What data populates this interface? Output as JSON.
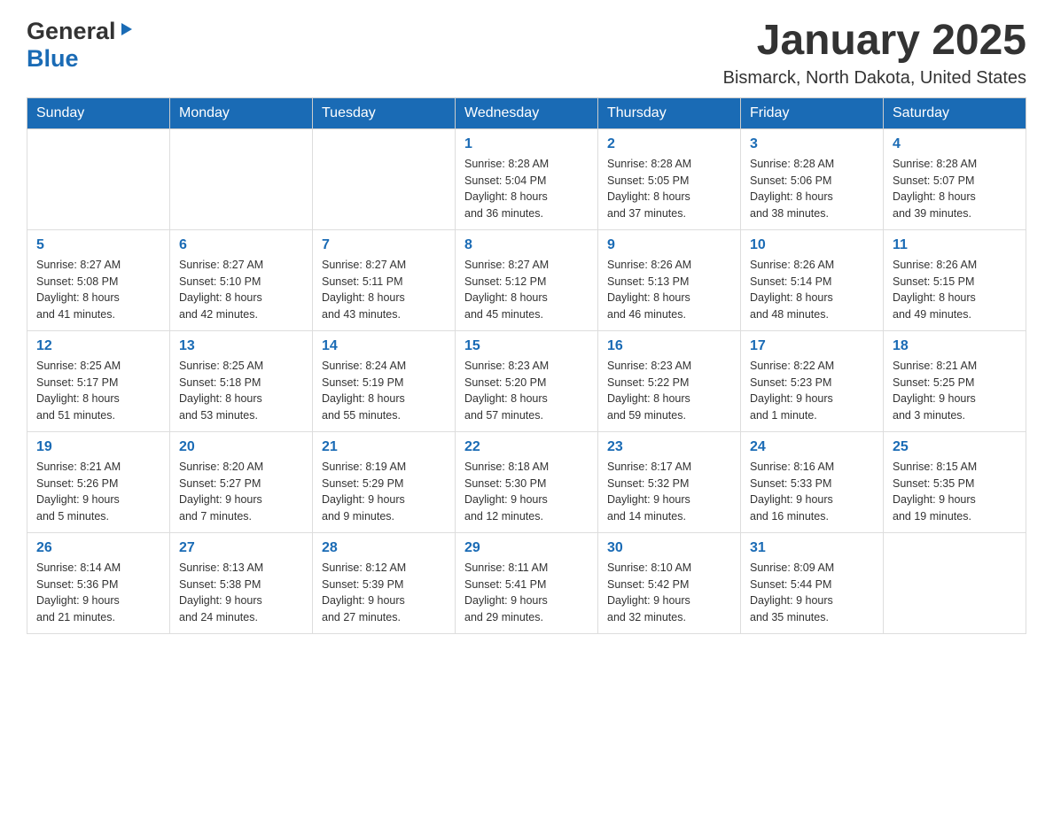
{
  "header": {
    "logo_general": "General",
    "logo_blue": "Blue",
    "month_title": "January 2025",
    "location": "Bismarck, North Dakota, United States"
  },
  "days_of_week": [
    "Sunday",
    "Monday",
    "Tuesday",
    "Wednesday",
    "Thursday",
    "Friday",
    "Saturday"
  ],
  "weeks": [
    {
      "days": [
        {
          "number": "",
          "info": ""
        },
        {
          "number": "",
          "info": ""
        },
        {
          "number": "",
          "info": ""
        },
        {
          "number": "1",
          "info": "Sunrise: 8:28 AM\nSunset: 5:04 PM\nDaylight: 8 hours\nand 36 minutes."
        },
        {
          "number": "2",
          "info": "Sunrise: 8:28 AM\nSunset: 5:05 PM\nDaylight: 8 hours\nand 37 minutes."
        },
        {
          "number": "3",
          "info": "Sunrise: 8:28 AM\nSunset: 5:06 PM\nDaylight: 8 hours\nand 38 minutes."
        },
        {
          "number": "4",
          "info": "Sunrise: 8:28 AM\nSunset: 5:07 PM\nDaylight: 8 hours\nand 39 minutes."
        }
      ]
    },
    {
      "days": [
        {
          "number": "5",
          "info": "Sunrise: 8:27 AM\nSunset: 5:08 PM\nDaylight: 8 hours\nand 41 minutes."
        },
        {
          "number": "6",
          "info": "Sunrise: 8:27 AM\nSunset: 5:10 PM\nDaylight: 8 hours\nand 42 minutes."
        },
        {
          "number": "7",
          "info": "Sunrise: 8:27 AM\nSunset: 5:11 PM\nDaylight: 8 hours\nand 43 minutes."
        },
        {
          "number": "8",
          "info": "Sunrise: 8:27 AM\nSunset: 5:12 PM\nDaylight: 8 hours\nand 45 minutes."
        },
        {
          "number": "9",
          "info": "Sunrise: 8:26 AM\nSunset: 5:13 PM\nDaylight: 8 hours\nand 46 minutes."
        },
        {
          "number": "10",
          "info": "Sunrise: 8:26 AM\nSunset: 5:14 PM\nDaylight: 8 hours\nand 48 minutes."
        },
        {
          "number": "11",
          "info": "Sunrise: 8:26 AM\nSunset: 5:15 PM\nDaylight: 8 hours\nand 49 minutes."
        }
      ]
    },
    {
      "days": [
        {
          "number": "12",
          "info": "Sunrise: 8:25 AM\nSunset: 5:17 PM\nDaylight: 8 hours\nand 51 minutes."
        },
        {
          "number": "13",
          "info": "Sunrise: 8:25 AM\nSunset: 5:18 PM\nDaylight: 8 hours\nand 53 minutes."
        },
        {
          "number": "14",
          "info": "Sunrise: 8:24 AM\nSunset: 5:19 PM\nDaylight: 8 hours\nand 55 minutes."
        },
        {
          "number": "15",
          "info": "Sunrise: 8:23 AM\nSunset: 5:20 PM\nDaylight: 8 hours\nand 57 minutes."
        },
        {
          "number": "16",
          "info": "Sunrise: 8:23 AM\nSunset: 5:22 PM\nDaylight: 8 hours\nand 59 minutes."
        },
        {
          "number": "17",
          "info": "Sunrise: 8:22 AM\nSunset: 5:23 PM\nDaylight: 9 hours\nand 1 minute."
        },
        {
          "number": "18",
          "info": "Sunrise: 8:21 AM\nSunset: 5:25 PM\nDaylight: 9 hours\nand 3 minutes."
        }
      ]
    },
    {
      "days": [
        {
          "number": "19",
          "info": "Sunrise: 8:21 AM\nSunset: 5:26 PM\nDaylight: 9 hours\nand 5 minutes."
        },
        {
          "number": "20",
          "info": "Sunrise: 8:20 AM\nSunset: 5:27 PM\nDaylight: 9 hours\nand 7 minutes."
        },
        {
          "number": "21",
          "info": "Sunrise: 8:19 AM\nSunset: 5:29 PM\nDaylight: 9 hours\nand 9 minutes."
        },
        {
          "number": "22",
          "info": "Sunrise: 8:18 AM\nSunset: 5:30 PM\nDaylight: 9 hours\nand 12 minutes."
        },
        {
          "number": "23",
          "info": "Sunrise: 8:17 AM\nSunset: 5:32 PM\nDaylight: 9 hours\nand 14 minutes."
        },
        {
          "number": "24",
          "info": "Sunrise: 8:16 AM\nSunset: 5:33 PM\nDaylight: 9 hours\nand 16 minutes."
        },
        {
          "number": "25",
          "info": "Sunrise: 8:15 AM\nSunset: 5:35 PM\nDaylight: 9 hours\nand 19 minutes."
        }
      ]
    },
    {
      "days": [
        {
          "number": "26",
          "info": "Sunrise: 8:14 AM\nSunset: 5:36 PM\nDaylight: 9 hours\nand 21 minutes."
        },
        {
          "number": "27",
          "info": "Sunrise: 8:13 AM\nSunset: 5:38 PM\nDaylight: 9 hours\nand 24 minutes."
        },
        {
          "number": "28",
          "info": "Sunrise: 8:12 AM\nSunset: 5:39 PM\nDaylight: 9 hours\nand 27 minutes."
        },
        {
          "number": "29",
          "info": "Sunrise: 8:11 AM\nSunset: 5:41 PM\nDaylight: 9 hours\nand 29 minutes."
        },
        {
          "number": "30",
          "info": "Sunrise: 8:10 AM\nSunset: 5:42 PM\nDaylight: 9 hours\nand 32 minutes."
        },
        {
          "number": "31",
          "info": "Sunrise: 8:09 AM\nSunset: 5:44 PM\nDaylight: 9 hours\nand 35 minutes."
        },
        {
          "number": "",
          "info": ""
        }
      ]
    }
  ]
}
